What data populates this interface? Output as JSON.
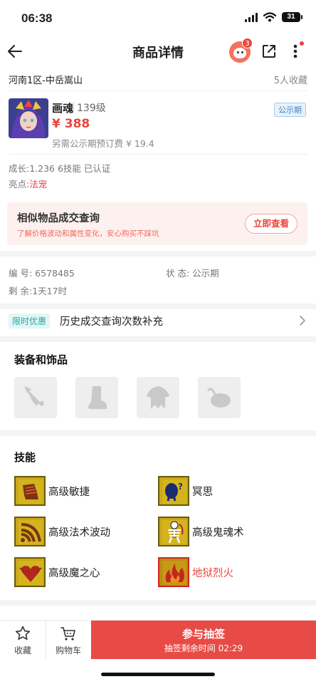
{
  "status_bar": {
    "time": "06:38",
    "battery": "31"
  },
  "nav": {
    "title": "商品详情",
    "cart_badge": "3"
  },
  "server": {
    "name": "河南1区-中岳嵩山",
    "favorites": "5人收藏"
  },
  "item": {
    "name": "画魂",
    "level": "139级",
    "price": "¥ 388",
    "deposit": "另需公示期预订费 ¥ 19.4",
    "public_tag": "公示期"
  },
  "attributes": {
    "growth": "成长:1.236 6技能 已认证",
    "highlight_label": "亮点:",
    "highlight_value": "法宠"
  },
  "query": {
    "title": "相似物品成交查询",
    "subtitle": "了解价格波动和属性变化，安心购买不踩坑",
    "button": "立即查看"
  },
  "info": {
    "id_label": "编 号:",
    "id_value": "6578485",
    "status_label": "状 态:",
    "status_value": "公示期",
    "remaining_label": "剩 余:",
    "remaining_value": "1天17时"
  },
  "promo": {
    "tag": "限时优惠",
    "text": "历史成交查询次数补充"
  },
  "equipment": {
    "title": "装备和饰品"
  },
  "skills": {
    "title": "技能",
    "items": [
      {
        "name": "高级敏捷",
        "icon": "boots-icon"
      },
      {
        "name": "冥思",
        "icon": "meditation-icon"
      },
      {
        "name": "高级法术波动",
        "icon": "wave-icon"
      },
      {
        "name": "高级鬼魂术",
        "icon": "skeleton-icon"
      },
      {
        "name": "高级魔之心",
        "icon": "heart-icon"
      },
      {
        "name": "地狱烈火",
        "icon": "fire-icon"
      }
    ]
  },
  "bottom_bar": {
    "favorite": "收藏",
    "cart": "购物车",
    "lottery": "参与抽签",
    "lottery_time": "抽签剩余时间 02:29"
  },
  "colors": {
    "accent": "#e84a45",
    "price": "#e8453c",
    "skill_gold": "#c9a81a"
  }
}
